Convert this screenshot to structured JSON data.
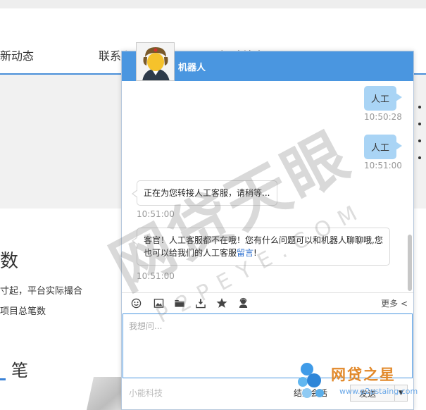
{
  "background": {
    "nav": [
      "新动态",
      "联系我们",
      "招聘纳士"
    ],
    "stat_title": "数",
    "stat_line1": "寸起，平台实际撮合",
    "stat_line2": "项目总笔数",
    "unit": "笔"
  },
  "chat": {
    "title": "机器人",
    "messages": [
      {
        "side": "right",
        "text": "人工",
        "time": "10:50:28"
      },
      {
        "side": "right",
        "text": "人工",
        "time": "10:51:00"
      },
      {
        "side": "left",
        "text": "正在为您转接人工客服，请稍等...",
        "time": "10:51:00"
      },
      {
        "side": "left",
        "text_before": "客官！人工客服都不在哦！您有什么问题可以和机器人聊聊哦,您也可以给我们的人工客服",
        "link": "留言",
        "text_after": "!",
        "time": "10:51:00"
      }
    ],
    "toolbar": {
      "icons": [
        "emoji-icon",
        "image-icon",
        "folder-icon",
        "download-icon",
        "star-icon",
        "agent-icon"
      ],
      "more": "更多 <"
    },
    "input_placeholder": "我想问...",
    "footer": {
      "brand": "小能科技",
      "end": "结束会话",
      "send": "发送",
      "send_caret": "▼"
    }
  },
  "watermark": {
    "main": "网贷天眼",
    "sub": "P2PEYE.COM",
    "logo_text": "网贷之星",
    "logo_url": "www.p2pstaing.com"
  },
  "colors": {
    "accent": "#4a96e0",
    "bubble_right": "#a9d4f5",
    "logo_orange": "#e2892a"
  }
}
